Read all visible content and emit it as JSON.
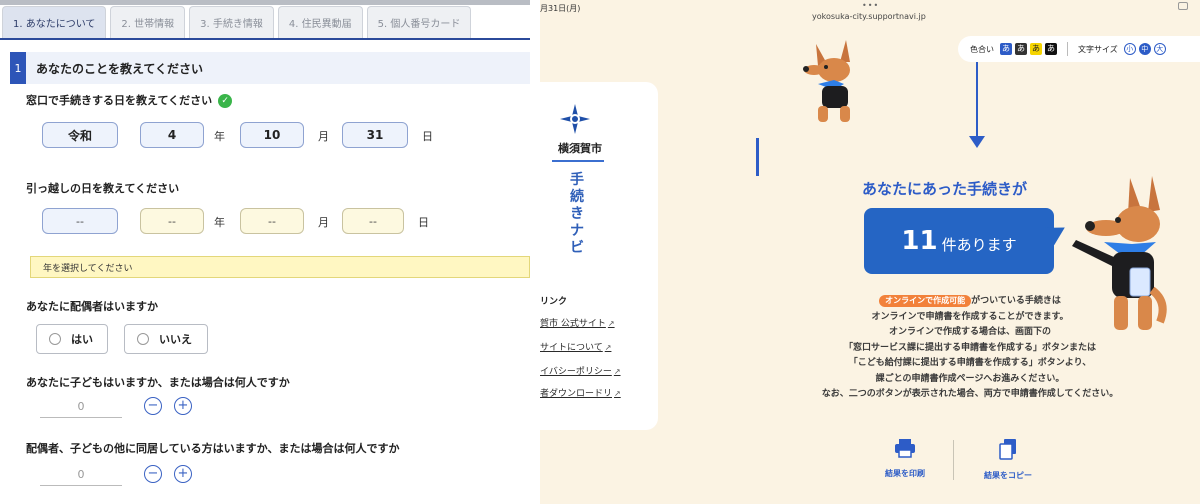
{
  "left": {
    "tabs": [
      "1. あなたについて",
      "2. 世帯情報",
      "3. 手続き情報",
      "4. 住民異動届",
      "5. 個人番号カード"
    ],
    "section": {
      "number": "1",
      "title": "あなたのことを教えてください"
    },
    "q1": {
      "label": "窓口で手続きする日を教えてください",
      "era": "令和",
      "year": "4",
      "month": "10",
      "day": "31",
      "unit_year": "年",
      "unit_month": "月",
      "unit_day": "日"
    },
    "q2": {
      "label": "引っ越しの日を教えてください",
      "era": "--",
      "year": "--",
      "month": "--",
      "day": "--",
      "unit_year": "年",
      "unit_month": "月",
      "unit_day": "日",
      "alert": "年を選択してください"
    },
    "q3": {
      "label": "あなたに配偶者はいますか",
      "yes": "はい",
      "no": "いいえ"
    },
    "q4": {
      "label": "あなたに子どもはいますか、または場合は何人ですか",
      "value": "0",
      "minus": "−",
      "plus": "+"
    },
    "q5": {
      "label": "配偶者、子どもの他に同居している方はいますか、または場合は何人ですか",
      "value": "0",
      "minus": "−",
      "plus": "+"
    }
  },
  "right": {
    "status": {
      "time": "月31日(月)",
      "dots": "•••",
      "url": "yokosuka-city.supportnavi.jp"
    },
    "sidebar": {
      "city": "横須賀市",
      "app_name": [
        "手",
        "続",
        "き",
        "ナ",
        "ビ"
      ],
      "links_head": "リンク",
      "links": [
        "賀市 公式サイト",
        "サイトについて",
        "イバシーポリシー",
        "者ダウンロードリ"
      ]
    },
    "controls": {
      "color_label": "色合い",
      "swatches": [
        "あ",
        "あ",
        "あ",
        "あ"
      ],
      "size_label": "文字サイズ",
      "sizes": [
        "小",
        "中",
        "大"
      ]
    },
    "headline": "あなたにあった手続きが",
    "count": {
      "number": "11",
      "suffix": "件あります"
    },
    "badge": "オンラインで作成可能",
    "body": [
      "がついている手続きは",
      "オンラインで申請書を作成することができます。",
      "オンラインで作成する場合は、画面下の",
      "「窓口サービス課に提出する申請書を作成する」ボタンまたは",
      "「こども給付課に提出する申請書を作成する」ボタンより、",
      "課ごとの申請書作成ページへお進みください。",
      "なお、二つのボタンが表示された場合、両方で申請書作成してください。"
    ],
    "actions": {
      "print": "結果を印刷",
      "copy": "結果をコピー"
    },
    "colors": {
      "accent": "#2d5cc7",
      "badge": "#f2813a",
      "background": "#fbf3e3"
    }
  }
}
